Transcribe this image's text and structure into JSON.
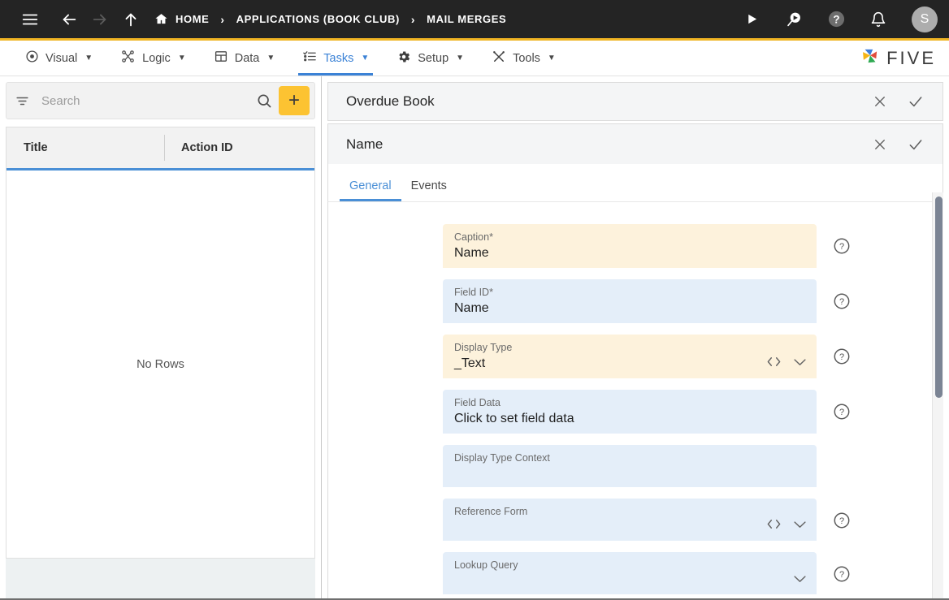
{
  "topbar": {
    "menu_icon": "hamburger-icon",
    "back_icon": "arrow-left-icon",
    "forward_icon": "arrow-right-icon",
    "up_icon": "arrow-up-icon",
    "home_icon": "home-icon",
    "breadcrumbs": [
      {
        "label": "HOME"
      },
      {
        "label": "APPLICATIONS (BOOK CLUB)"
      },
      {
        "label": "MAIL MERGES"
      }
    ],
    "separator": "›",
    "actions": [
      {
        "name": "run-icon",
        "title": "Run"
      },
      {
        "name": "preview-icon",
        "title": "Preview"
      },
      {
        "name": "help-circle-icon",
        "title": "Help"
      },
      {
        "name": "notifications-bell-icon",
        "title": "Notifications"
      }
    ],
    "avatar_initial": "S",
    "accent_color": "#efb423",
    "background_color": "#242424"
  },
  "menubar": {
    "items": [
      {
        "label": "Visual",
        "icon": "eye-icon",
        "active": false
      },
      {
        "label": "Logic",
        "icon": "logic-nodes-icon",
        "active": false
      },
      {
        "label": "Data",
        "icon": "table-grid-icon",
        "active": false
      },
      {
        "label": "Tasks",
        "icon": "checklist-icon",
        "active": true
      },
      {
        "label": "Setup",
        "icon": "gear-icon",
        "active": false
      },
      {
        "label": "Tools",
        "icon": "wrench-screwdriver-icon",
        "active": false
      }
    ],
    "caret": "▼",
    "brand": "FIVE",
    "active_color": "#3b82d6"
  },
  "left_panel": {
    "filter_icon": "filter-icon",
    "search_placeholder": "Search",
    "search_value": "",
    "search_icon": "search-icon",
    "add_label": "+",
    "add_color": "#fcc332",
    "grid": {
      "columns": [
        "Title",
        "Action ID"
      ],
      "rows": [],
      "empty_message": "No Rows",
      "header_underline_color": "#4a8fd6"
    }
  },
  "main_panel": {
    "headers": [
      {
        "title": "Overdue Book",
        "close_icon": "close-icon",
        "confirm_icon": "check-icon"
      },
      {
        "title": "Name",
        "close_icon": "close-icon",
        "confirm_icon": "check-icon"
      }
    ],
    "tabs": [
      {
        "label": "General",
        "active": true
      },
      {
        "label": "Events",
        "active": false
      }
    ],
    "fields": [
      {
        "label": "Caption",
        "required": true,
        "value": "Name",
        "style": "cream",
        "has_help": true,
        "icons": []
      },
      {
        "label": "Field ID",
        "required": true,
        "value": "Name",
        "style": "blue",
        "has_help": true,
        "icons": []
      },
      {
        "label": "Display Type",
        "required": false,
        "value": "_Text",
        "style": "cream",
        "has_help": true,
        "icons": [
          "code-brackets-icon",
          "chevron-down-icon"
        ]
      },
      {
        "label": "Field Data",
        "required": false,
        "value": "Click to set field data",
        "style": "blue",
        "has_help": true,
        "icons": []
      },
      {
        "label": "Display Type Context",
        "required": false,
        "value": "",
        "style": "blue",
        "has_help": false,
        "icons": []
      },
      {
        "label": "Reference Form",
        "required": false,
        "value": "",
        "style": "blue",
        "has_help": true,
        "icons": [
          "code-brackets-icon",
          "chevron-down-icon"
        ]
      },
      {
        "label": "Lookup Query",
        "required": false,
        "value": "",
        "style": "blue",
        "has_help": true,
        "icons": [
          "chevron-down-icon"
        ]
      }
    ],
    "required_marker": "*",
    "help_icon": "help-circle-icon",
    "scrollbar": {
      "name": "vertical-scrollbar",
      "thumb_color": "#7b8494"
    }
  }
}
